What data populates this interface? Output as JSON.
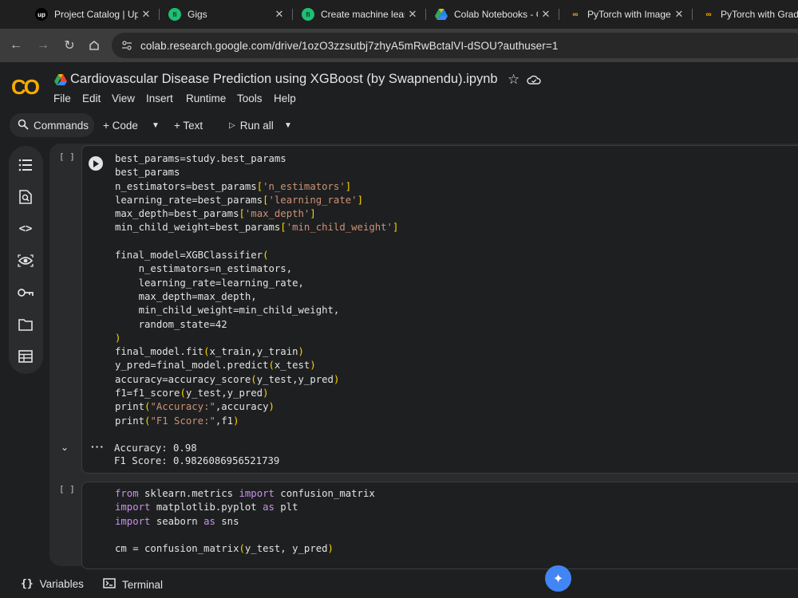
{
  "tabs": [
    {
      "label": "Project Catalog | Upw",
      "icon": "upwork-icon",
      "favicon_text": "up"
    },
    {
      "label": "Gigs",
      "icon": "fiverr-icon",
      "favicon_text": "fi"
    },
    {
      "label": "Create machine learn",
      "icon": "fiverr-icon",
      "favicon_text": "fi"
    },
    {
      "label": "Colab Notebooks - G",
      "icon": "google-drive-icon",
      "favicon_text": ""
    },
    {
      "label": "PyTorch with Images",
      "icon": "colab-icon",
      "favicon_text": "co"
    },
    {
      "label": "PyTorch with Gradien",
      "icon": "colab-icon",
      "favicon_text": "co"
    }
  ],
  "address": {
    "url": "colab.research.google.com/drive/1ozO3zzsutbj7zhyA5mRwBctalVI-dSOU?authuser=1"
  },
  "colab": {
    "logo_text": "CO",
    "title": "Cardiovascular Disease Prediction using XGBoost (by Swapnendu).ipynb",
    "menu": [
      "File",
      "Edit",
      "View",
      "Insert",
      "Runtime",
      "Tools",
      "Help"
    ]
  },
  "toolbar": {
    "commands": "Commands",
    "code": "+ Code",
    "text": "+ Text",
    "run_all": "Run all"
  },
  "rail_icons": [
    "table-of-contents-icon",
    "find-icon",
    "code-snippets-icon",
    "variables-inspector-icon",
    "secrets-key-icon",
    "files-folder-icon",
    "data-table-icon"
  ],
  "cells": {
    "cell1": {
      "bracket": "[ ]",
      "lines": [
        "best_params=study.best_params",
        "best_params",
        "n_estimators=best_params['n_estimators']",
        "learning_rate=best_params['learning_rate']",
        "max_depth=best_params['max_depth']",
        "min_child_weight=best_params['min_child_weight']",
        "",
        "final_model=XGBClassifier(",
        "    n_estimators=n_estimators,",
        "    learning_rate=learning_rate,",
        "    max_depth=max_depth,",
        "    min_child_weight=min_child_weight,",
        "    random_state=42",
        ")",
        "final_model.fit(x_train,y_train)",
        "y_pred=final_model.predict(x_test)",
        "accuracy=accuracy_score(y_test,y_pred)",
        "f1=f1_score(y_test,y_pred)",
        "print(\"Accuracy:\",accuracy)",
        "print(\"F1 Score:\",f1)"
      ],
      "output": [
        "Accuracy: 0.98",
        "F1 Score: 0.9826086956521739"
      ]
    },
    "cell2": {
      "bracket": "[ ]",
      "lines": [
        "from sklearn.metrics import confusion_matrix",
        "import matplotlib.pyplot as plt",
        "import seaborn as sns",
        "",
        "cm = confusion_matrix(y_test, y_pred)"
      ]
    }
  },
  "bottom": {
    "variables": "Variables",
    "terminal": "Terminal"
  },
  "colors": {
    "accent_orange": "#f9ab00",
    "string": "#ce9178",
    "keyword": "#c792ea",
    "bracket": "#ffd700",
    "gemini": "#4285f4"
  }
}
